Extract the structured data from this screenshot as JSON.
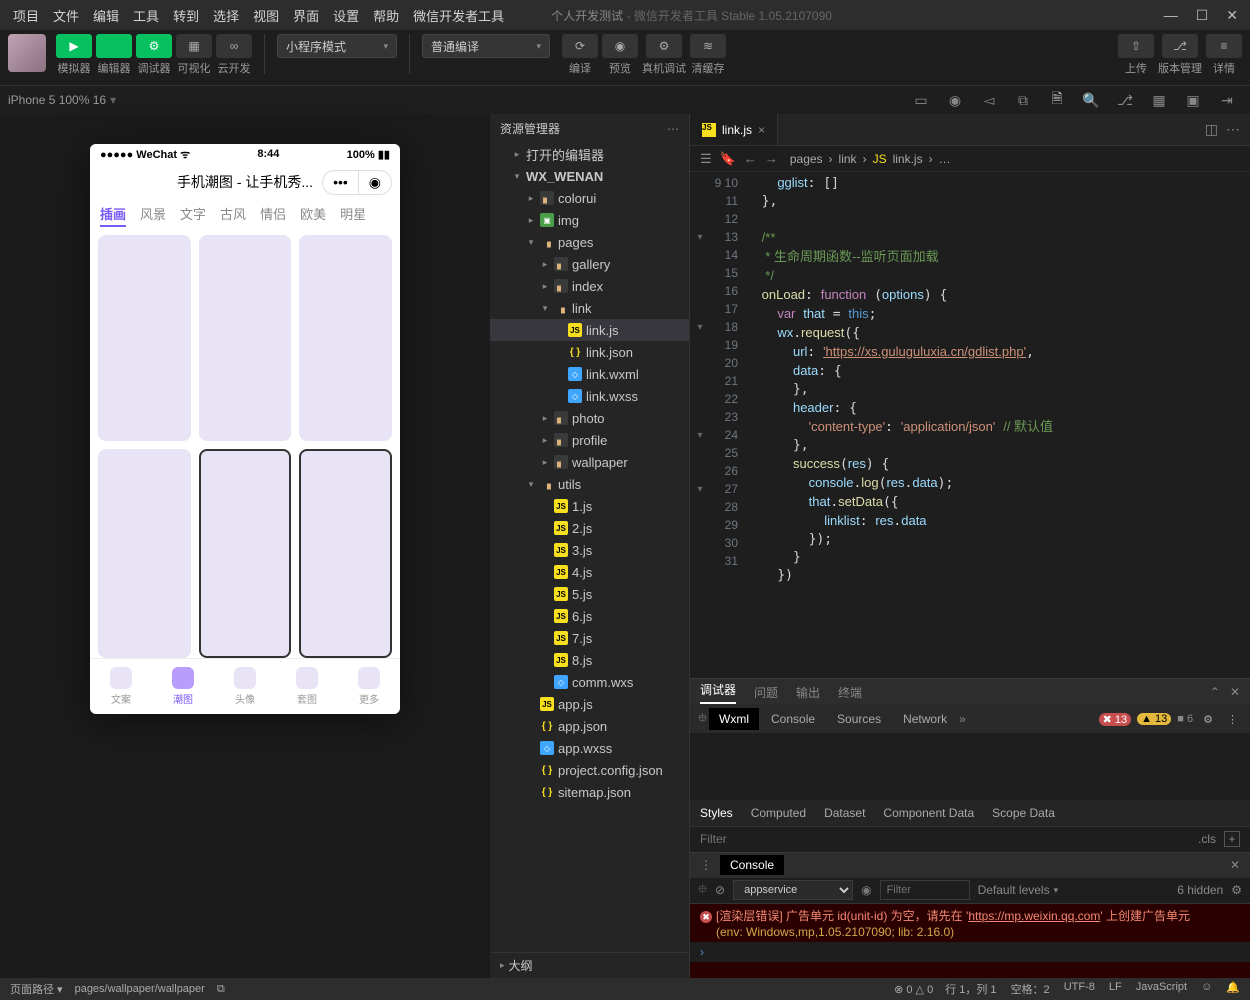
{
  "menubar": [
    "项目",
    "文件",
    "编辑",
    "工具",
    "转到",
    "选择",
    "视图",
    "界面",
    "设置",
    "帮助",
    "微信开发者工具"
  ],
  "title_app": "个人开发测试",
  "title_suffix": " - 微信开发者工具 Stable 1.05.2107090",
  "toolbar": {
    "groups": [
      {
        "icon": "▶",
        "label": "模拟器",
        "green": true
      },
      {
        "icon": "</>",
        "label": "编辑器",
        "green": true
      },
      {
        "icon": "⚙",
        "label": "调试器",
        "green": true
      },
      {
        "icon": "▦",
        "label": "可视化",
        "green": false
      },
      {
        "icon": "∞",
        "label": "云开发",
        "green": false
      }
    ],
    "mode_dd": "小程序模式",
    "compile_dd": "普通编译",
    "actions": [
      {
        "icon": "⟳",
        "label": "编译"
      },
      {
        "icon": "◉",
        "label": "预览"
      },
      {
        "icon": "⚙",
        "label": "真机调试"
      },
      {
        "icon": "≋",
        "label": "清缓存"
      }
    ],
    "right": [
      {
        "icon": "⇧",
        "label": "上传"
      },
      {
        "icon": "⎇",
        "label": "版本管理"
      },
      {
        "icon": "≡",
        "label": "详情"
      }
    ]
  },
  "devicebar": {
    "device": "iPhone 5 100% 16"
  },
  "phone": {
    "carrier": "WeChat",
    "time": "8:44",
    "battery": "100%",
    "title": "手机潮图 - 让手机秀...",
    "top_tabs": [
      "插画",
      "风景",
      "文字",
      "古风",
      "情侣",
      "欧美",
      "明星"
    ],
    "bottom": [
      "文案",
      "潮图",
      "头像",
      "套图",
      "更多"
    ]
  },
  "explorer": {
    "title": "资源管理器",
    "open_editors": "打开的编辑器",
    "project": "WX_WENAN",
    "tree": [
      {
        "d": 2,
        "t": "folder",
        "tw": "▸",
        "n": "colorui"
      },
      {
        "d": 2,
        "t": "img",
        "tw": "▸",
        "n": "img"
      },
      {
        "d": 2,
        "t": "folder-o",
        "tw": "▾",
        "n": "pages"
      },
      {
        "d": 3,
        "t": "folder",
        "tw": "▸",
        "n": "gallery"
      },
      {
        "d": 3,
        "t": "folder",
        "tw": "▸",
        "n": "index"
      },
      {
        "d": 3,
        "t": "folder-o",
        "tw": "▾",
        "n": "link"
      },
      {
        "d": 4,
        "t": "js",
        "tw": "",
        "n": "link.js",
        "sel": true
      },
      {
        "d": 4,
        "t": "jsonb",
        "tw": "",
        "n": "link.json"
      },
      {
        "d": 4,
        "t": "wxml",
        "tw": "",
        "n": "link.wxml"
      },
      {
        "d": 4,
        "t": "wxss",
        "tw": "",
        "n": "link.wxss"
      },
      {
        "d": 3,
        "t": "folder",
        "tw": "▸",
        "n": "photo"
      },
      {
        "d": 3,
        "t": "folder",
        "tw": "▸",
        "n": "profile"
      },
      {
        "d": 3,
        "t": "folder",
        "tw": "▸",
        "n": "wallpaper"
      },
      {
        "d": 2,
        "t": "folder-o",
        "tw": "▾",
        "n": "utils"
      },
      {
        "d": 3,
        "t": "js",
        "tw": "",
        "n": "1.js"
      },
      {
        "d": 3,
        "t": "js",
        "tw": "",
        "n": "2.js"
      },
      {
        "d": 3,
        "t": "js",
        "tw": "",
        "n": "3.js"
      },
      {
        "d": 3,
        "t": "js",
        "tw": "",
        "n": "4.js"
      },
      {
        "d": 3,
        "t": "js",
        "tw": "",
        "n": "5.js"
      },
      {
        "d": 3,
        "t": "js",
        "tw": "",
        "n": "6.js"
      },
      {
        "d": 3,
        "t": "js",
        "tw": "",
        "n": "7.js"
      },
      {
        "d": 3,
        "t": "js",
        "tw": "",
        "n": "8.js"
      },
      {
        "d": 3,
        "t": "wxml",
        "tw": "",
        "n": "comm.wxs"
      },
      {
        "d": 2,
        "t": "js",
        "tw": "",
        "n": "app.js"
      },
      {
        "d": 2,
        "t": "jsonb",
        "tw": "",
        "n": "app.json"
      },
      {
        "d": 2,
        "t": "wxss",
        "tw": "",
        "n": "app.wxss"
      },
      {
        "d": 2,
        "t": "jsonb",
        "tw": "",
        "n": "project.config.json"
      },
      {
        "d": 2,
        "t": "jsonb",
        "tw": "",
        "n": "sitemap.json"
      }
    ],
    "outline": "大纲"
  },
  "editor": {
    "tab": "link.js",
    "crumbs": [
      "pages",
      "link",
      "link.js",
      "…"
    ],
    "lines_start": 9,
    "code_comment": "生命周期函数--监听页面加载",
    "url": "https://xs.guluguluxia.cn/gdlist.php",
    "default_cmt": "默认值"
  },
  "debugger": {
    "tabs": [
      "调试器",
      "问题",
      "输出",
      "终端"
    ],
    "devtabs": [
      "Wxml",
      "Console",
      "Sources",
      "Network"
    ],
    "err": "13",
    "warn": "13",
    "info": "6",
    "styles_tabs": [
      "Styles",
      "Computed",
      "Dataset",
      "Component Data",
      "Scope Data"
    ],
    "filter_ph": "Filter",
    "cls": ".cls",
    "console_label": "Console",
    "scope": "appservice",
    "levels": "Default levels",
    "hidden": "6 hidden",
    "err_msg_1": "[渲染层错误] 广告单元 id(unit-id) 为空，请先在 '",
    "err_link": "https://mp.weixin.qq.com",
    "err_msg_2": "' 上创建广告单元",
    "err_env": "(env: Windows,mp,1.05.2107090; lib: 2.16.0)"
  },
  "statusbar": {
    "path_label": "页面路径",
    "path": "pages/wallpaper/wallpaper",
    "err0": "0",
    "warn0": "0",
    "ln": "行 1，列 1",
    "spaces": "空格：2",
    "enc": "UTF-8",
    "eol": "LF",
    "lang": "JavaScript"
  }
}
